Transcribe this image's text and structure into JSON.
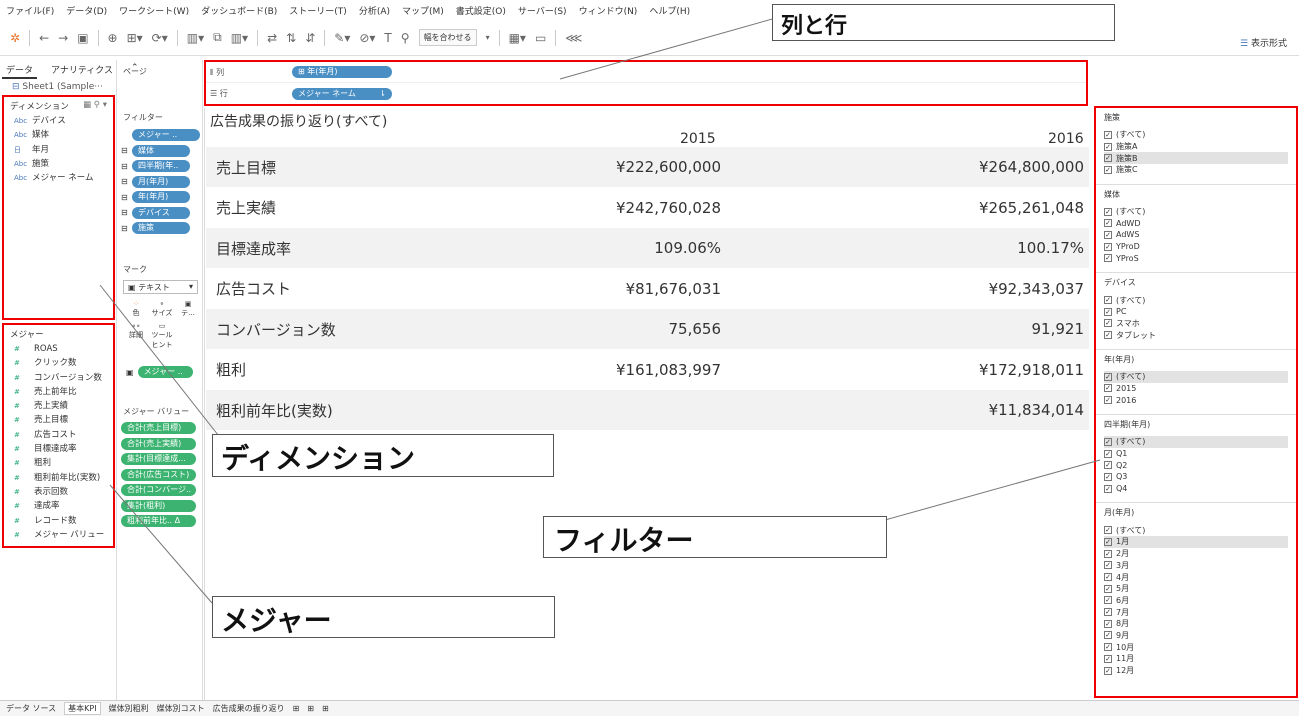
{
  "menu": [
    "ファイル(F)",
    "データ(D)",
    "ワークシート(W)",
    "ダッシュボード(B)",
    "ストーリー(T)",
    "分析(A)",
    "マップ(M)",
    "書式設定(O)",
    "サーバー(S)",
    "ウィンドウ(N)",
    "ヘルプ(H)"
  ],
  "toolbar": {
    "fit_label": "幅を合わせる",
    "show_me": "表示形式"
  },
  "left": {
    "tab_data": "データ",
    "tab_analytics": "アナリティクス",
    "datasource": "Sheet1 (Sample···",
    "dimensions_header": "ディメンション",
    "dimensions": [
      {
        "tag": "Abc",
        "name": "デバイス"
      },
      {
        "tag": "Abc",
        "name": "媒体"
      },
      {
        "tag": "日",
        "name": "年月"
      },
      {
        "tag": "Abc",
        "name": "施策"
      },
      {
        "tag": "Abc",
        "name": "メジャー ネーム"
      }
    ],
    "measures_header": "メジャー",
    "measures": [
      "ROAS",
      "クリック数",
      "コンバージョン数",
      "売上前年比",
      "売上実績",
      "売上目標",
      "広告コスト",
      "目標達成率",
      "粗利",
      "粗利前年比(実数)",
      "表示回数",
      "達成率",
      "レコード数",
      "メジャー バリュー"
    ]
  },
  "mid": {
    "pages": "ページ",
    "filters": "フィルター",
    "filter_pills": [
      "メジャー ..",
      "媒体",
      "四半期(年..",
      "月(年月)",
      "年(年月)",
      "デバイス",
      "施策"
    ],
    "marks": "マーク",
    "mark_type": "テキスト",
    "mark_buttons": [
      "色",
      "サイズ",
      "テ...",
      "詳細",
      "ツール ヒント"
    ],
    "marks_pill": "メジャー ..",
    "measure_values": "メジャー バリュー",
    "mv_pills": [
      "合計(売上目標)",
      "合計(売上実績)",
      "集計(目標達成...",
      "合計(広告コスト)",
      "合計(コンバージ..",
      "集計(粗利)",
      "粗利前年比.. Δ"
    ]
  },
  "shelves": {
    "columns_label": "列",
    "columns_pill": "年(年月)",
    "rows_label": "行",
    "rows_pill": "メジャー ネーム"
  },
  "viz": {
    "title": "広告成果の振り返り(すべて)",
    "years": [
      "2015",
      "2016"
    ],
    "rows": [
      {
        "label": "売上目標",
        "v2015": "¥222,600,000",
        "v2016": "¥264,800,000"
      },
      {
        "label": "売上実績",
        "v2015": "¥242,760,028",
        "v2016": "¥265,261,048"
      },
      {
        "label": "目標達成率",
        "v2015": "109.06%",
        "v2016": "100.17%"
      },
      {
        "label": "広告コスト",
        "v2015": "¥81,676,031",
        "v2016": "¥92,343,037"
      },
      {
        "label": "コンバージョン数",
        "v2015": "75,656",
        "v2016": "91,921"
      },
      {
        "label": "粗利",
        "v2015": "¥161,083,997",
        "v2016": "¥172,918,011"
      },
      {
        "label": "粗利前年比(実数)",
        "v2015": "",
        "v2016": "¥11,834,014"
      }
    ]
  },
  "filters": [
    {
      "title": "施策",
      "items": [
        "(すべて)",
        "施策A",
        "施策B",
        "施策C"
      ],
      "highlight": "施策B"
    },
    {
      "title": "媒体",
      "items": [
        "(すべて)",
        "AdWD",
        "AdWS",
        "YProD",
        "YProS"
      ],
      "highlight": ""
    },
    {
      "title": "デバイス",
      "items": [
        "(すべて)",
        "PC",
        "スマホ",
        "タブレット"
      ],
      "highlight": ""
    },
    {
      "title": "年(年月)",
      "items": [
        "(すべて)",
        "2015",
        "2016"
      ],
      "highlight": "(すべて)"
    },
    {
      "title": "四半期(年月)",
      "items": [
        "(すべて)",
        "Q1",
        "Q2",
        "Q3",
        "Q4"
      ],
      "highlight": "(すべて)"
    },
    {
      "title": "月(年月)",
      "items": [
        "(すべて)",
        "1月",
        "2月",
        "3月",
        "4月",
        "5月",
        "6月",
        "7月",
        "8月",
        "9月",
        "10月",
        "11月",
        "12月"
      ],
      "highlight": "1月"
    }
  ],
  "callouts": {
    "rows_cols": "列と行",
    "dimension": "ディメンション",
    "filter": "フィルター",
    "measure": "メジャー"
  },
  "bottom_tabs": [
    "データ ソース",
    "基本KPI",
    "媒体別粗利",
    "媒体別コスト",
    "広告成果の振り返り"
  ],
  "colors": {
    "annotation_red": "#e00000",
    "pill_blue": "#4a8fc4",
    "pill_green": "#3cb371"
  }
}
